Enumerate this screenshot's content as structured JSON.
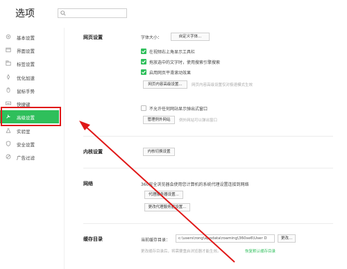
{
  "header": {
    "title": "选项",
    "search_placeholder": ""
  },
  "sidebar": {
    "items": [
      {
        "label": "基本设置",
        "icon": "gear-icon",
        "active": false
      },
      {
        "label": "界面设置",
        "icon": "window-icon",
        "active": false
      },
      {
        "label": "标签设置",
        "icon": "tab-icon",
        "active": false
      },
      {
        "label": "优化加速",
        "icon": "rocket-icon",
        "active": false
      },
      {
        "label": "鼠标手势",
        "icon": "mouse-icon",
        "active": false
      },
      {
        "label": "快捷键",
        "icon": "keyboard-icon",
        "active": false
      },
      {
        "label": "高级设置",
        "icon": "tools-icon",
        "active": true
      },
      {
        "label": "实验室",
        "icon": "flask-icon",
        "active": false
      },
      {
        "label": "安全设置",
        "icon": "shield-icon",
        "active": false
      },
      {
        "label": "广告过滤",
        "icon": "block-icon",
        "active": false
      }
    ]
  },
  "colors": {
    "accent": "#2fbf5b",
    "annotation": "#e01818"
  },
  "webpage": {
    "title": "网页设置",
    "font_size_label": "字体大小：",
    "custom_font_button": "自定义字体...",
    "options": [
      {
        "label": "在视频右上角显示工具栏",
        "checked": true
      },
      {
        "label": "拖放选中的文字时，使用搜索引擎搜索",
        "checked": true
      },
      {
        "label": "启用网页平滑滚动效果",
        "checked": true
      }
    ],
    "advanced_button": "网页内容高级设置...",
    "advanced_hint": "网页内容高级设置仅对极速模式生效",
    "popup_option": {
      "label": "不允许任何网站显示弹出式窗口",
      "checked": false
    },
    "exceptions_button": "管理例外网站",
    "exceptions_hint": "例外网站可以弹出窗口"
  },
  "kernel": {
    "title": "内核设置",
    "button": "内核切换设置"
  },
  "network": {
    "title": "网络",
    "desc": "360安全浏览器会使用您计算机的系统代理设置连接到网络",
    "proxy_button": "代理服务器设置...",
    "change_proxy_button": "更改代理服务器设置..."
  },
  "cache": {
    "title": "缓存目录",
    "current_label": "当前缓存目录：",
    "path_value": "c:\\users\\rong\\appdata\\roaming\\360se6\\User D",
    "change_button": "更改...",
    "hint": "更改缓存目录后，将需要重启浏览器才能生效。",
    "restore_link": "恢复默认缓存目录"
  }
}
